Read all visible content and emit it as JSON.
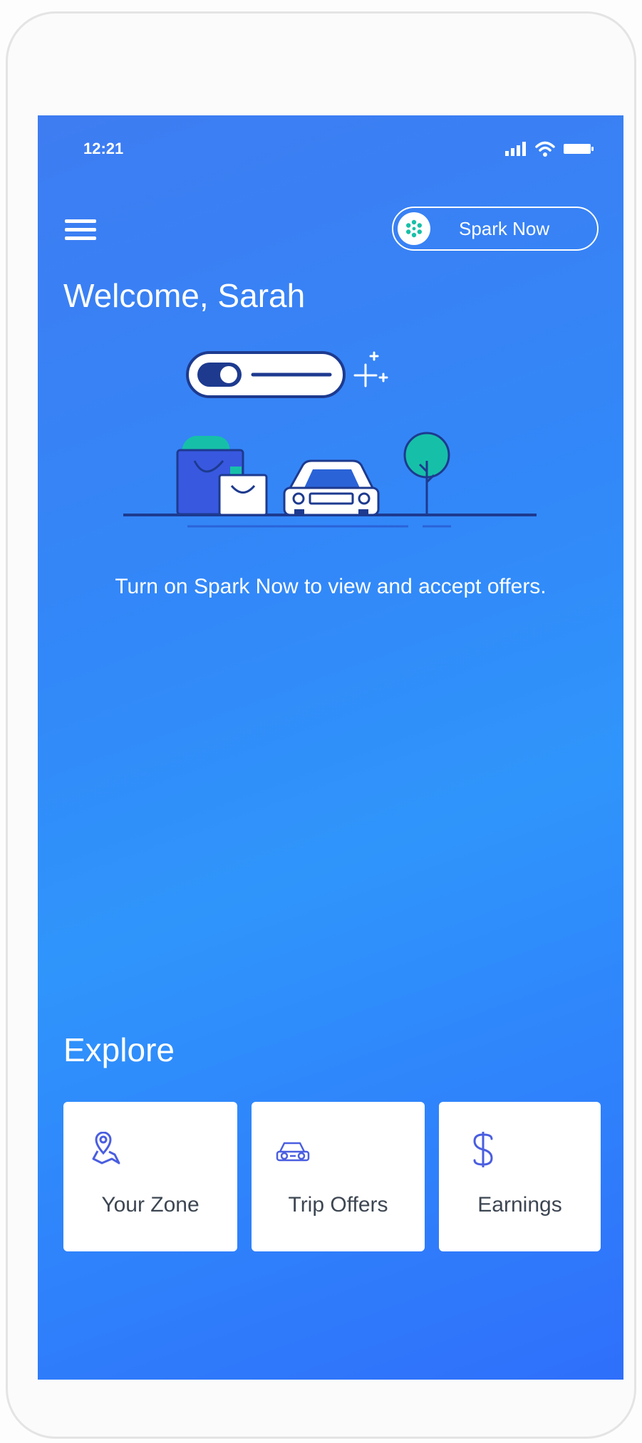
{
  "status": {
    "time": "12:21",
    "icons": [
      "signal-icon",
      "wifi-icon",
      "battery-icon"
    ]
  },
  "header": {
    "menu_icon": "hamburger-menu-icon",
    "spark_toggle_label": "Spark Now",
    "spark_toggle_on": false
  },
  "welcome": "Welcome, Sarah",
  "prompt": "Turn on Spark Now to view and accept offers.",
  "explore": {
    "title": "Explore",
    "cards": [
      {
        "label": "Your Zone",
        "icon": "map-pin-icon"
      },
      {
        "label": "Trip Offers",
        "icon": "car-icon"
      },
      {
        "label": "Earnings",
        "icon": "dollar-icon"
      }
    ]
  },
  "colors": {
    "gradient_start": "#3e7cf2",
    "gradient_mid": "#2f95fb",
    "gradient_end": "#2f6ffb",
    "accent_teal": "#16c0a8",
    "icon_blue": "#4a5ee0",
    "card_text": "#3d4652"
  }
}
